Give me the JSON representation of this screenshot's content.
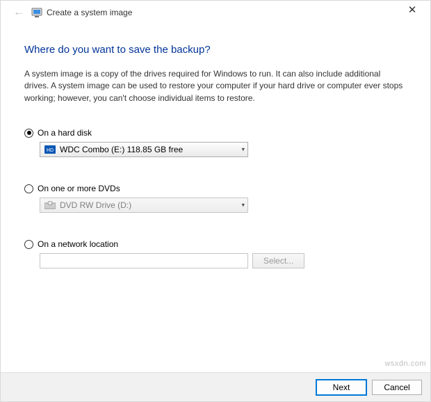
{
  "window": {
    "title": "Create a system image"
  },
  "heading": "Where do you want to save the backup?",
  "description": "A system image is a copy of the drives required for Windows to run. It can also include additional drives. A system image can be used to restore your computer if your hard drive or computer ever stops working; however, you can't choose individual items to restore.",
  "options": {
    "hard_disk": {
      "label": "On a hard disk",
      "selected": "WDC Combo (E:)  118.85 GB free"
    },
    "dvd": {
      "label": "On one or more DVDs",
      "selected": "DVD RW Drive (D:)"
    },
    "network": {
      "label": "On a network location",
      "select_button": "Select..."
    }
  },
  "footer": {
    "next": "Next",
    "cancel": "Cancel"
  },
  "watermark": "wsxdn.com"
}
